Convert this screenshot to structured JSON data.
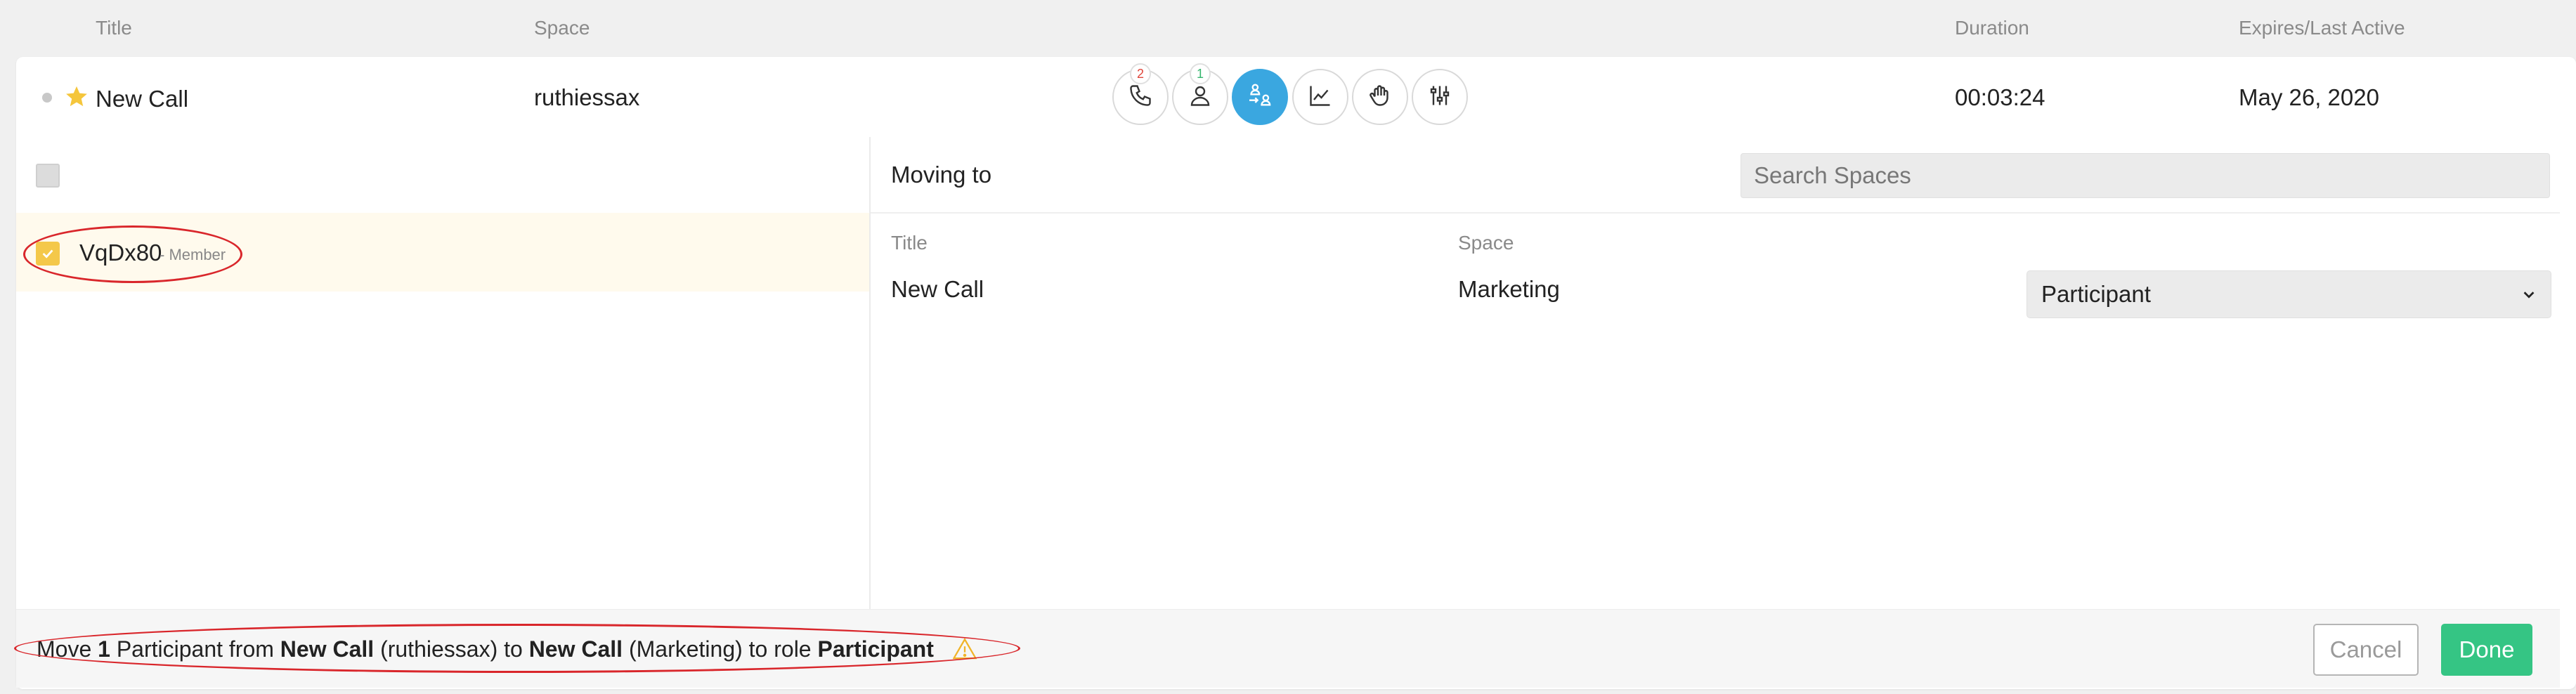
{
  "columns": {
    "title": "Title",
    "space": "Space",
    "duration": "Duration",
    "expires": "Expires/Last Active"
  },
  "call_row": {
    "title": "New Call",
    "space": "ruthiessax",
    "duration": "00:03:24",
    "expires": "May 26, 2020",
    "star_icon": "star-icon",
    "action_icons": [
      {
        "icon": "phone-icon",
        "badge": "2",
        "badge_color": "#e0463b"
      },
      {
        "icon": "person-icon",
        "badge": "1",
        "badge_color": "#35b56d"
      },
      {
        "icon": "move-participants-icon",
        "active": true
      },
      {
        "icon": "chart-icon"
      },
      {
        "icon": "raise-hand-icon"
      },
      {
        "icon": "sliders-icon"
      }
    ]
  },
  "left_panel": {
    "member": {
      "name": "VqDx80",
      "role": "- Member",
      "checked": true
    }
  },
  "right_panel": {
    "moving_to_label": "Moving to",
    "search_placeholder": "Search Spaces",
    "table_headers": {
      "title": "Title",
      "space": "Space"
    },
    "destination": {
      "title": "New Call",
      "space": "Marketing",
      "role_selected": "Participant"
    }
  },
  "footer": {
    "summary_move": "Move",
    "summary_count": "1",
    "summary_participant": "Participant from",
    "summary_from_call": "New Call",
    "summary_from_space": "(ruthiessax)",
    "summary_to": "to",
    "summary_to_call": "New Call",
    "summary_to_space": "(Marketing)",
    "summary_to_role": "to role",
    "summary_role": "Participant",
    "warning_icon": "warning-icon",
    "cancel_label": "Cancel",
    "done_label": "Done"
  },
  "colors": {
    "accent": "#3aa7e0",
    "done": "#35c584",
    "checkbox": "#f4c84a",
    "highlight_row": "#fffaed",
    "annotation": "#d9262b"
  }
}
